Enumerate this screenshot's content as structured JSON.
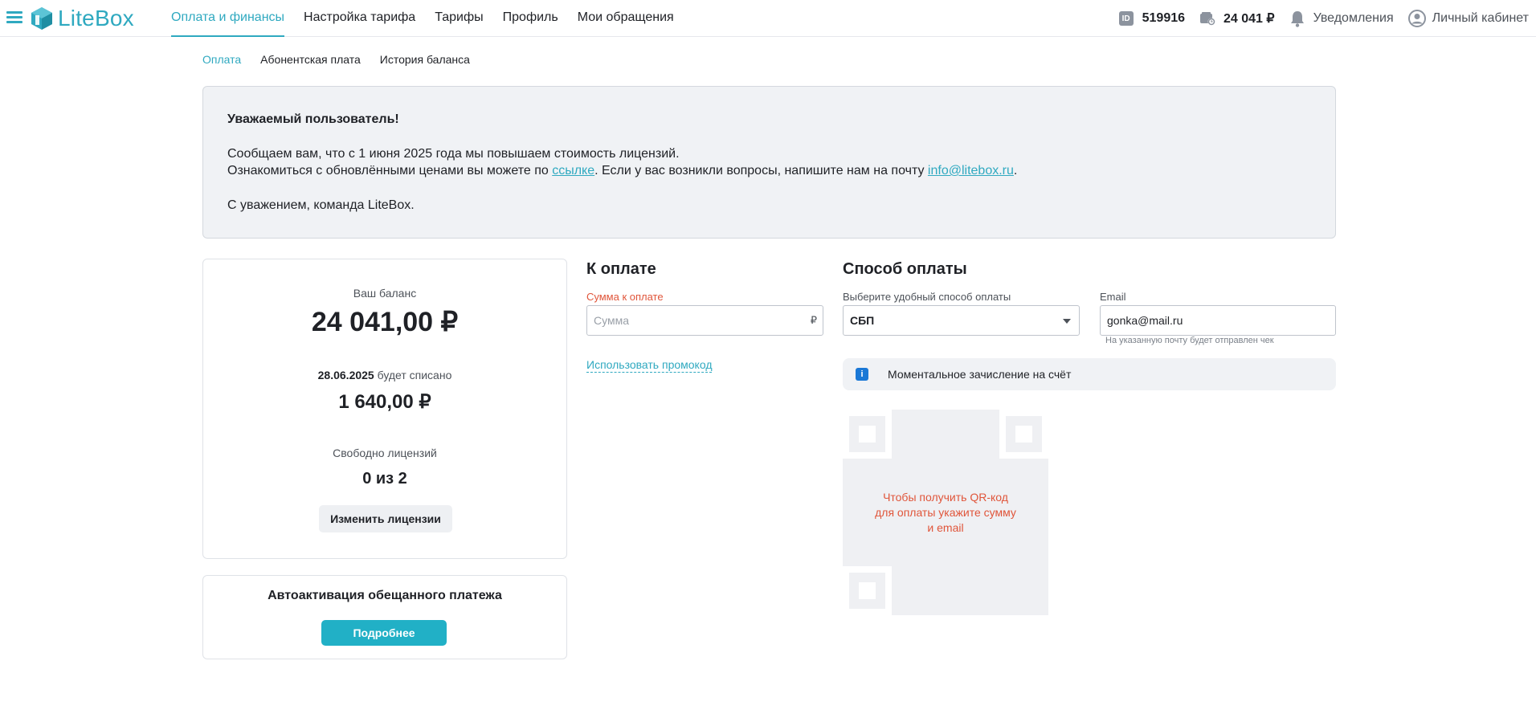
{
  "header": {
    "logo_text": "LiteBox",
    "nav": [
      {
        "label": "Оплата и финансы",
        "active": true
      },
      {
        "label": "Настройка тарифа",
        "active": false
      },
      {
        "label": "Тарифы",
        "active": false
      },
      {
        "label": "Профиль",
        "active": false
      },
      {
        "label": "Мои обращения",
        "active": false
      }
    ],
    "id_badge": "ID",
    "id_value": "519916",
    "balance_short": "24 041 ₽",
    "notifications_label": "Уведомления",
    "account_label": "Личный кабинет"
  },
  "subtabs": [
    {
      "label": "Оплата",
      "active": true
    },
    {
      "label": "Абонентская плата",
      "active": false
    },
    {
      "label": "История баланса",
      "active": false
    }
  ],
  "notice": {
    "title": "Уважаемый пользователь!",
    "line1": "Сообщаем вам, что с 1 июня 2025 года мы повышаем стоимость лицензий.",
    "line2_before": "Ознакомиться с обновлёнными ценами вы можете по ",
    "link_text": "ссылке",
    "line2_middle": ". Если у вас возникли вопросы, напишите нам на почту ",
    "email_link": "info@litebox.ru",
    "line2_after": ".",
    "signature": "С уважением, команда LiteBox."
  },
  "balance": {
    "label": "Ваш баланс",
    "value": "24 041,00 ₽",
    "withdraw_date": "28.06.2025",
    "withdraw_text": " будет списано",
    "withdraw_value": "1 640,00 ₽",
    "licenses_label": "Свободно лицензий",
    "licenses_value": "0 из 2",
    "change_button": "Изменить лицензии"
  },
  "auto": {
    "title": "Автоактивация обещанного платежа",
    "button": "Подробнее"
  },
  "payment": {
    "title": "К оплате",
    "amount_label": "Сумма к оплате",
    "amount_placeholder": "Сумма",
    "currency": "₽",
    "promo_link": "Использовать промокод"
  },
  "method": {
    "title": "Способ оплаты",
    "select_label": "Выберите удобный способ оплаты",
    "selected": "СБП",
    "email_label": "Email",
    "email_value": "gonka@mail.ru",
    "email_hint": "На указанную почту будет отправлен чек",
    "info_icon": "i",
    "info_text": "Моментальное зачисление на счёт",
    "qr_line1": "Чтобы получить QR-код",
    "qr_line2": "для оплаты укажите сумму",
    "qr_line3": "и email"
  }
}
